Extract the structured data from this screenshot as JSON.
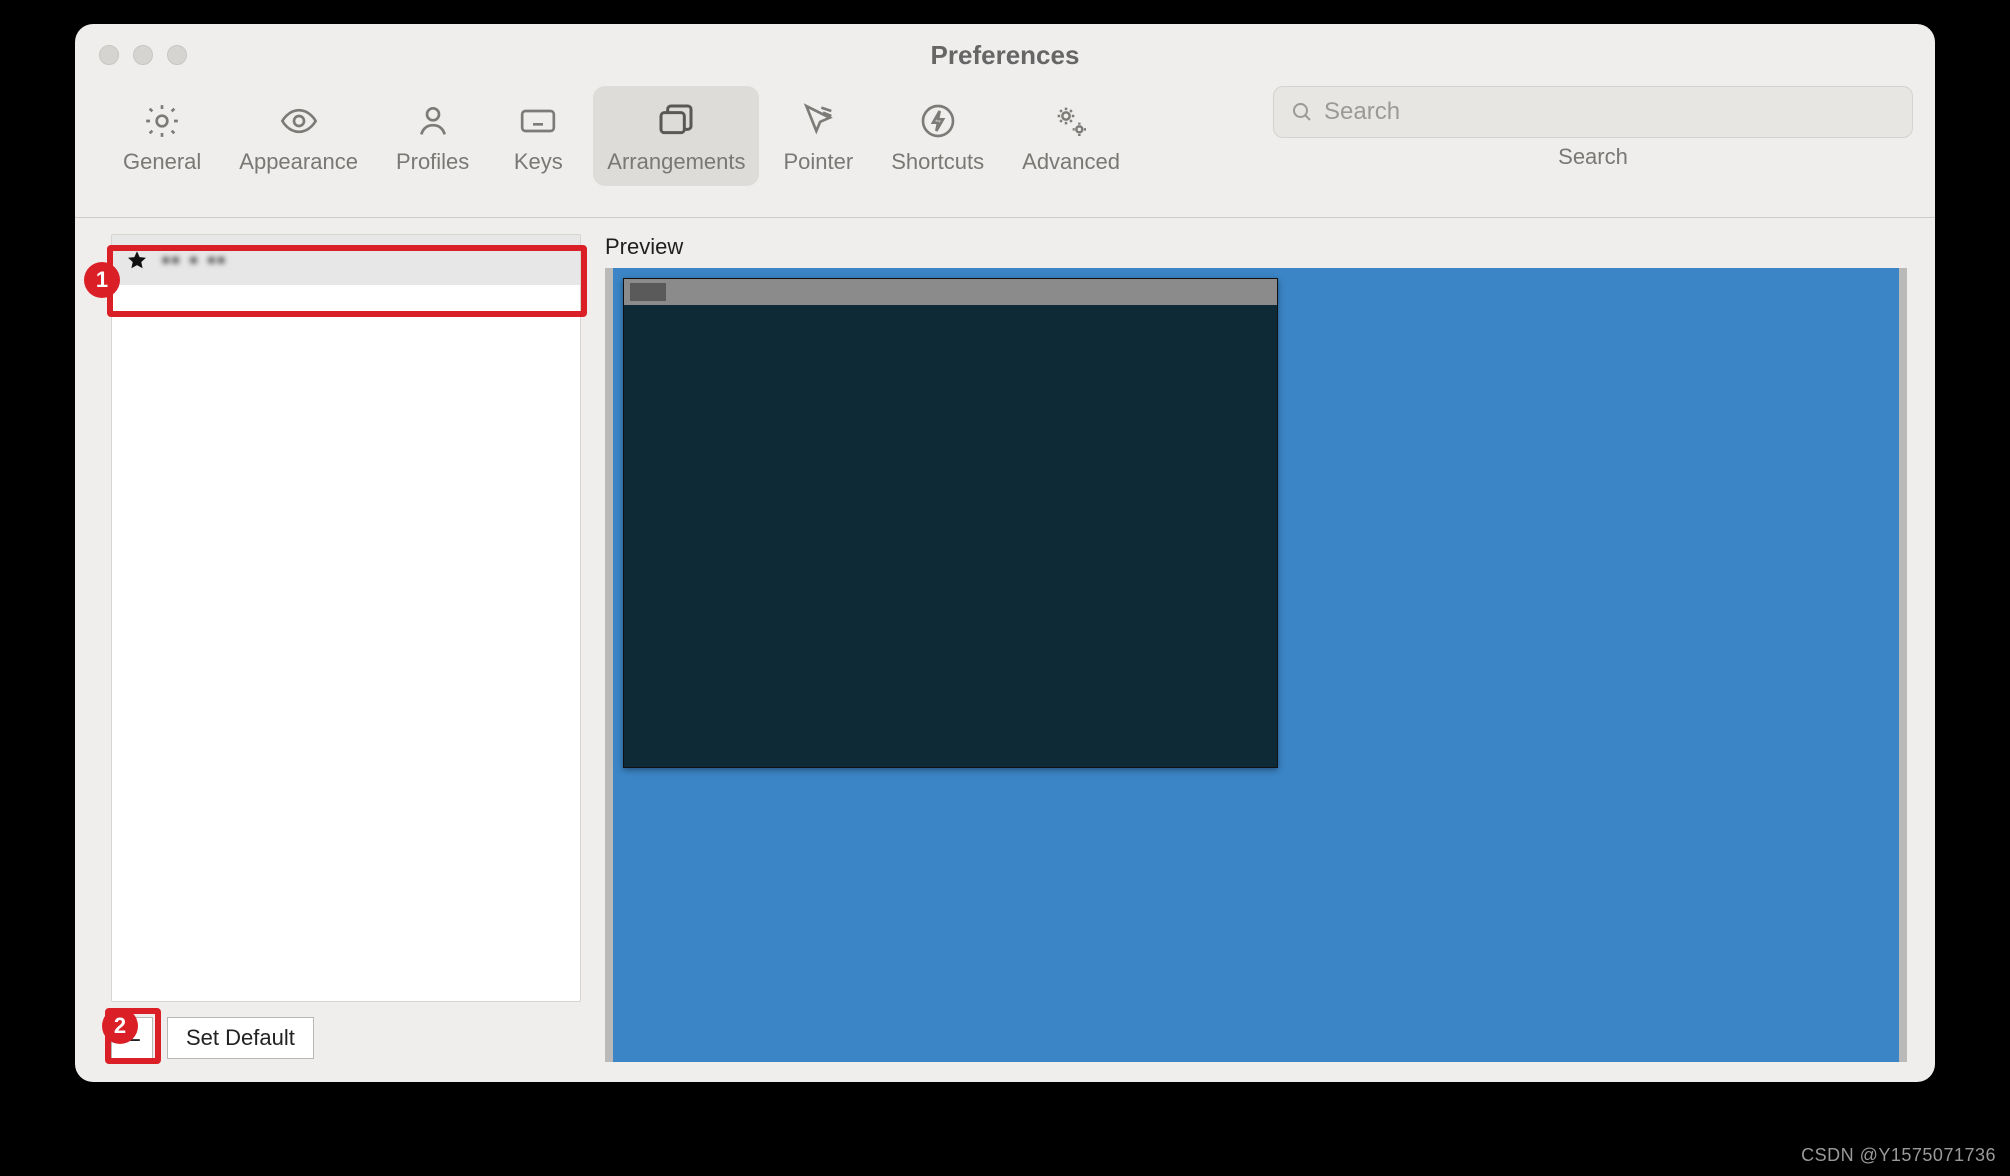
{
  "window": {
    "title": "Preferences"
  },
  "toolbar": {
    "items": [
      {
        "id": "general",
        "label": "General"
      },
      {
        "id": "appearance",
        "label": "Appearance"
      },
      {
        "id": "profiles",
        "label": "Profiles"
      },
      {
        "id": "keys",
        "label": "Keys"
      },
      {
        "id": "arrangements",
        "label": "Arrangements",
        "active": true
      },
      {
        "id": "pointer",
        "label": "Pointer"
      },
      {
        "id": "shortcuts",
        "label": "Shortcuts"
      },
      {
        "id": "advanced",
        "label": "Advanced"
      }
    ],
    "search": {
      "placeholder": "Search",
      "label": "Search"
    }
  },
  "arrangements": {
    "list": [
      {
        "starred": true,
        "name": "▪▪ ▪ ▪▪"
      }
    ],
    "remove_label": "–",
    "set_default_label": "Set Default"
  },
  "preview": {
    "label": "Preview"
  },
  "callouts": {
    "one": "1",
    "two": "2"
  },
  "watermark": "CSDN @Y1575071736"
}
